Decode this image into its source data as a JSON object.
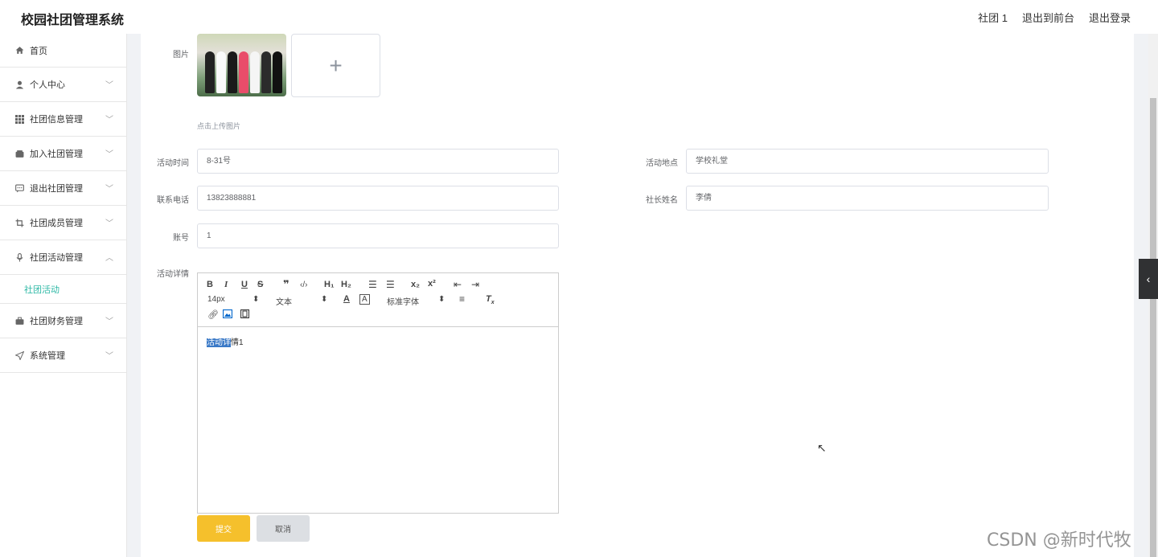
{
  "header": {
    "title": "校园社团管理系统",
    "links": [
      "社团 1",
      "退出到前台",
      "退出登录"
    ]
  },
  "sidebar": {
    "items": [
      {
        "label": "首页",
        "icon": "home-icon"
      },
      {
        "label": "个人中心",
        "icon": "user-icon"
      },
      {
        "label": "社团信息管理",
        "icon": "grid-icon"
      },
      {
        "label": "加入社团管理",
        "icon": "wallet-icon"
      },
      {
        "label": "退出社团管理",
        "icon": "chat-icon"
      },
      {
        "label": "社团成员管理",
        "icon": "crop-icon"
      },
      {
        "label": "社团活动管理",
        "icon": "microphone-icon"
      },
      {
        "label": "社团财务管理",
        "icon": "briefcase-icon"
      },
      {
        "label": "系统管理",
        "icon": "send-icon"
      }
    ],
    "active_sub": "社团活动"
  },
  "form": {
    "image_label": "图片",
    "upload_hint": "点击上传图片",
    "time_label": "活动时间",
    "time_value": "8-31号",
    "location_label": "活动地点",
    "location_value": "学校礼堂",
    "phone_label": "联系电话",
    "phone_value": "13823888881",
    "leader_label": "社长姓名",
    "leader_value": "李倩",
    "account_label": "账号",
    "account_value": "1",
    "detail_label": "活动详情",
    "editor": {
      "font_size": "14px",
      "heading": "文本",
      "font_family": "标准字体",
      "content_highlight": "活动详",
      "content_rest": "情1"
    },
    "submit_label": "提交",
    "cancel_label": "取消"
  },
  "watermark": "CSDN @新时代牧"
}
